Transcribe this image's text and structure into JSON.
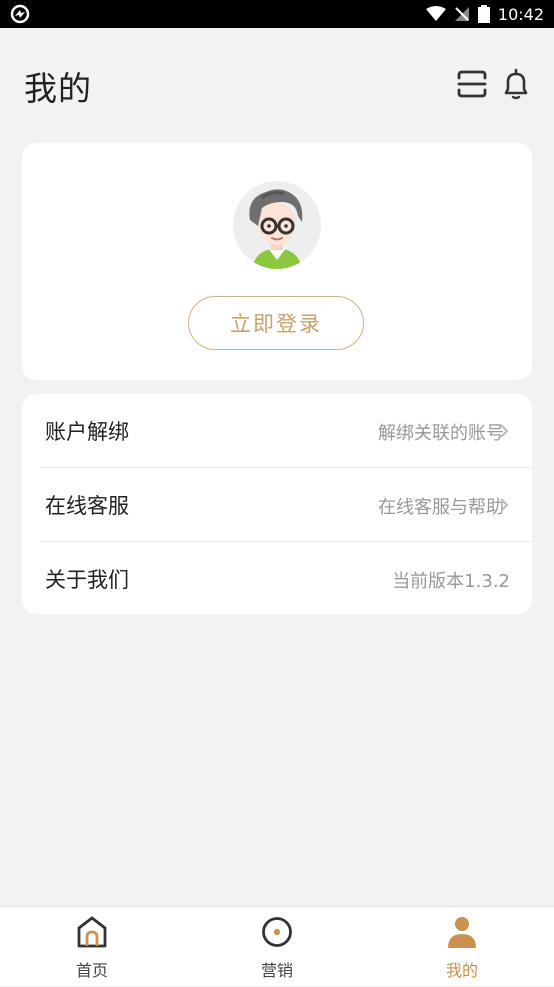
{
  "status_bar": {
    "time": "10:42"
  },
  "header": {
    "title": "我的",
    "icons": [
      "scan-icon",
      "bell-icon"
    ]
  },
  "profile": {
    "login_label": "立即登录"
  },
  "menu": {
    "items": [
      {
        "label": "账户解绑",
        "sub": "解绑关联的账号",
        "has_arrow": true
      },
      {
        "label": "在线客服",
        "sub": "在线客服与帮助",
        "has_arrow": true
      },
      {
        "label": "关于我们",
        "sub": "当前版本1.3.2",
        "has_arrow": false
      }
    ]
  },
  "tabbar": {
    "tabs": [
      {
        "label": "首页",
        "icon": "home-icon",
        "active": false
      },
      {
        "label": "营销",
        "icon": "compass-icon",
        "active": false
      },
      {
        "label": "我的",
        "icon": "profile-icon",
        "active": true
      }
    ]
  },
  "colors": {
    "accent": "#c9924f",
    "login_border": "#d6b184",
    "background": "#f2f2f2"
  }
}
